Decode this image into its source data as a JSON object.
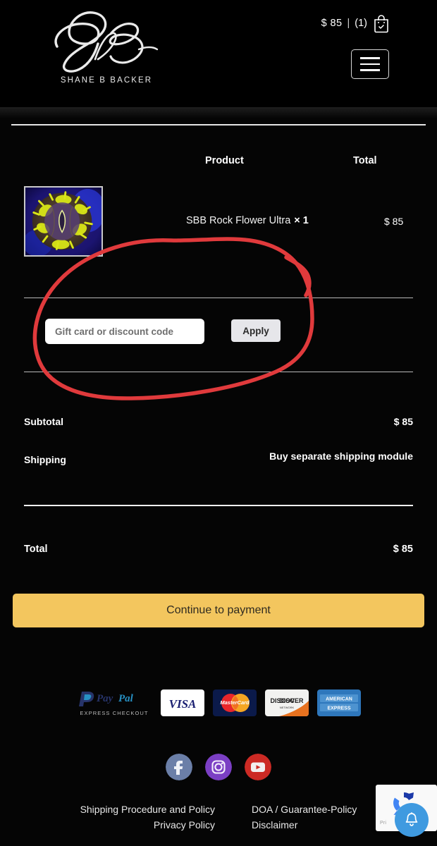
{
  "header": {
    "logo_word": "SHANE B BACKER",
    "logo_icon": "sbb-monogram-icon",
    "cart_amount": "$ 85",
    "cart_separator": "|",
    "cart_count": "(1)",
    "cart_icon": "shopping-bag-icon",
    "menu_icon": "hamburger-menu-icon"
  },
  "cart_table": {
    "product_header": "Product",
    "total_header": "Total",
    "items": [
      {
        "thumbnail_icon": "coral-product-thumbnail",
        "name": "SBB Rock Flower Ultra",
        "quantity": "× 1",
        "total": "$ 85"
      }
    ]
  },
  "discount": {
    "placeholder": "Gift card or discount code",
    "value": "",
    "apply_label": "Apply"
  },
  "totals": [
    {
      "label": "Subtotal",
      "value": "$ 85"
    },
    {
      "label": "Shipping",
      "value": "Buy separate shipping module"
    },
    {
      "label": "Total",
      "value": "$ 85"
    }
  ],
  "cta": {
    "label": "Continue to payment",
    "color": "#f3c65e"
  },
  "payments": {
    "paypal_label": "PayPal",
    "paypal_sub": "EXPRESS CHECKOUT",
    "cards": [
      {
        "name": "visa-card-badge",
        "label": "VISA"
      },
      {
        "name": "mastercard-card-badge",
        "label": "MasterCard"
      },
      {
        "name": "discover-card-badge",
        "label": "DISCOVER"
      },
      {
        "name": "amex-card-badge",
        "label": "AMERICAN EXPRESS"
      }
    ]
  },
  "social": [
    {
      "name": "facebook-icon",
      "color": "#6b7fa8"
    },
    {
      "name": "instagram-icon",
      "color": "#7b3fc4"
    },
    {
      "name": "youtube-icon",
      "color": "#cc2a24"
    }
  ],
  "footer": {
    "left_links": [
      "Shipping Procedure and Policy",
      "Privacy Policy"
    ],
    "right_links": [
      "DOA / Guarantee-Policy",
      "Disclaimer"
    ]
  },
  "recaptcha": {
    "text": "Pri",
    "icon": "recaptcha-logo-icon"
  },
  "notification": {
    "icon": "bell-icon",
    "color": "#3f9ae0"
  },
  "annotation": {
    "shape": "hand-drawn-red-ellipse",
    "color": "#e03a3c"
  }
}
